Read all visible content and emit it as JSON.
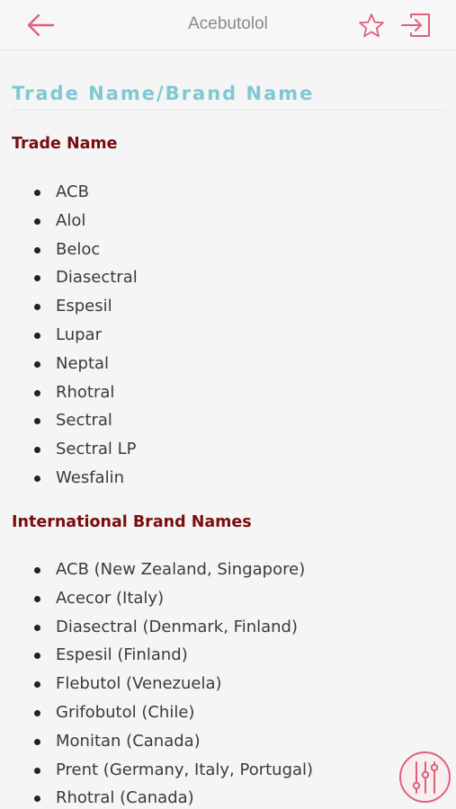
{
  "header": {
    "title": "Acebutolol",
    "back_icon": "arrow-left-icon",
    "favorite_icon": "star-outline-icon",
    "exit_icon": "exit-icon"
  },
  "colors": {
    "accent": "#e0607a",
    "section_title": "#7ec9d4",
    "subheading": "#7a0d0d",
    "body_text": "#3a3a3a"
  },
  "content": {
    "section_title": "Trade Name/Brand Name",
    "trade": {
      "heading": "Trade Name",
      "items": [
        "ACB",
        "Alol",
        "Beloc",
        "Diasectral",
        "Espesil",
        "Lupar",
        "Neptal",
        "Rhotral",
        "Sectral",
        "Sectral LP",
        "Wesfalin"
      ]
    },
    "international": {
      "heading": "International Brand Names",
      "items": [
        "ACB (New Zealand, Singapore)",
        "Acecor (Italy)",
        "Diasectral (Denmark, Finland)",
        "Espesil (Finland)",
        "Flebutol (Venezuela)",
        "Grifobutol (Chile)",
        "Monitan (Canada)",
        "Prent (Germany, Italy, Portugal)",
        "Rhotral (Canada)"
      ]
    }
  },
  "fab": {
    "icon": "sliders-icon"
  }
}
